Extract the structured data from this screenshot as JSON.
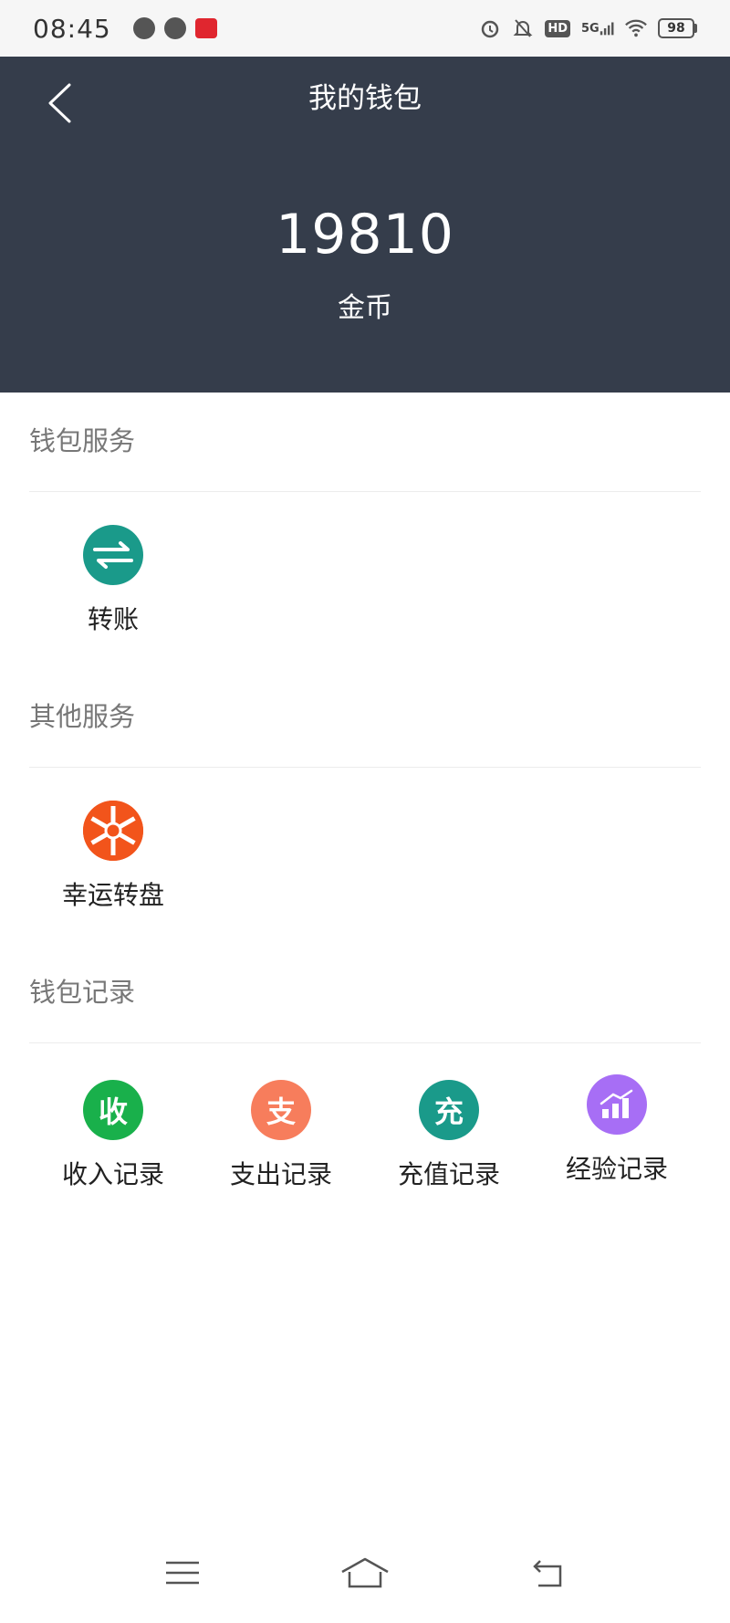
{
  "status_bar": {
    "time": "08:45",
    "network": "5G",
    "hd": "HD",
    "battery": "98"
  },
  "header": {
    "title": "我的钱包",
    "balance": "19810",
    "unit": "金币"
  },
  "sections": {
    "wallet_service": {
      "title": "钱包服务",
      "items": [
        {
          "label": "转账",
          "icon": "transfer-icon",
          "color": "#1a9a8a"
        }
      ]
    },
    "other_service": {
      "title": "其他服务",
      "items": [
        {
          "label": "幸运转盘",
          "icon": "lucky-wheel-icon",
          "color": "#f2541b"
        }
      ]
    },
    "wallet_records": {
      "title": "钱包记录",
      "items": [
        {
          "label": "收入记录",
          "glyph": "收",
          "icon": "income-icon",
          "color": "#19b04b"
        },
        {
          "label": "支出记录",
          "glyph": "支",
          "icon": "expense-icon",
          "color": "#f77d5c"
        },
        {
          "label": "充值记录",
          "glyph": "充",
          "icon": "recharge-icon",
          "color": "#1a9a8a"
        },
        {
          "label": "经验记录",
          "icon": "experience-chart-icon",
          "color": "#a76ef5"
        }
      ]
    }
  },
  "colors": {
    "header_bg": "#353d4b",
    "section_title": "#777777"
  }
}
